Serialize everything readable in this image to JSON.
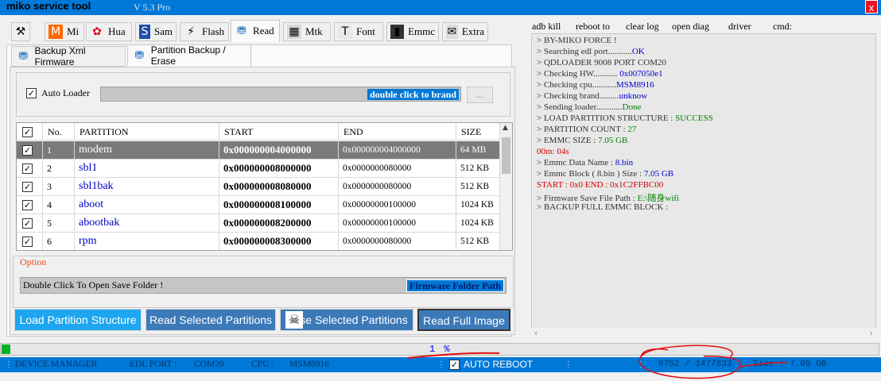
{
  "window": {
    "title": "miko service tool",
    "version": "V 5.3 Pro",
    "close_label": "x"
  },
  "tabs": [
    {
      "label": "",
      "icon": "tools-icon"
    },
    {
      "label": "Mi",
      "icon": "mi-icon"
    },
    {
      "label": "Hua",
      "icon": "huawei-icon"
    },
    {
      "label": "Sam",
      "icon": "samsung-icon"
    },
    {
      "label": "Flash",
      "icon": "lightning-icon"
    },
    {
      "label": "Read",
      "icon": "database-icon"
    },
    {
      "label": "Mtk",
      "icon": "chip-icon"
    },
    {
      "label": "Font",
      "icon": "font-icon"
    },
    {
      "label": "Emmc",
      "icon": "emmc-icon"
    },
    {
      "label": "Extra",
      "icon": "extra-icon"
    }
  ],
  "subtabs": [
    {
      "label": "Backup Xml Firmware",
      "icon": "database-icon"
    },
    {
      "label": "Partition Backup / Erase",
      "icon": "database-icon"
    }
  ],
  "auto_loader": {
    "label": "Auto Loader",
    "checked": true,
    "brand_text": "double click to brand",
    "browse_label": "..."
  },
  "table": {
    "columns": [
      "No.",
      "PARTITION",
      "START",
      "END",
      "SIZE"
    ],
    "rows": [
      {
        "no": "1",
        "name": "modem",
        "start": "0x000000004000000",
        "end": "0x000000004000000",
        "size": "64 MB",
        "selected": true
      },
      {
        "no": "2",
        "name": "sbl1",
        "start": "0x000000008000000",
        "end": "0x0000000080000",
        "size": "512 KB"
      },
      {
        "no": "3",
        "name": "sbl1bak",
        "start": "0x000000008080000",
        "end": "0x0000000080000",
        "size": "512 KB"
      },
      {
        "no": "4",
        "name": "aboot",
        "start": "0x000000008100000",
        "end": "0x00000000100000",
        "size": "1024 KB"
      },
      {
        "no": "5",
        "name": "abootbak",
        "start": "0x000000008200000",
        "end": "0x00000000100000",
        "size": "1024 KB"
      },
      {
        "no": "6",
        "name": "rpm",
        "start": "0x000000008300000",
        "end": "0x0000000080000",
        "size": "512 KB"
      }
    ]
  },
  "option": {
    "label": "Option",
    "save_folder_text": "Double Click To Open Save Folder !",
    "firmware_path_label": "Firmware Folder Path"
  },
  "buttons": {
    "load": "Load Partition Structure",
    "read": "Read Selected Partitions",
    "erase": "se Selected Partitions",
    "full": "Read Full Image"
  },
  "colors": {
    "accent": "#0078d7",
    "selected_button": "#1ea6f0",
    "button": "#3c79b8",
    "success": "#008000",
    "error": "#d00000"
  },
  "right_tabs": [
    "adb kill",
    "reboot to",
    "clear log",
    "open diag",
    "driver",
    "cmd:"
  ],
  "log": [
    {
      "parts": [
        {
          "t": " > BY-MIKO FORCE !",
          "c": "#333"
        }
      ]
    },
    {
      "parts": [
        {
          "t": " > Searching edl port...........",
          "c": "#333"
        },
        {
          "t": "OK",
          "c": "#0000d0"
        }
      ]
    },
    {
      "parts": [
        {
          "t": " > QDLOADER 9008 PORT COM20",
          "c": "#333"
        }
      ]
    },
    {
      "parts": [
        {
          "t": " > Checking HW........... ",
          "c": "#333"
        },
        {
          "t": "0x007050e1",
          "c": "#0000d0"
        }
      ]
    },
    {
      "parts": [
        {
          "t": " > Checking cpu...........",
          "c": "#333"
        },
        {
          "t": "MSM8916",
          "c": "#0000d0"
        }
      ]
    },
    {
      "parts": [
        {
          "t": " > Checking brand.........",
          "c": "#333"
        },
        {
          "t": "unknow",
          "c": "#0000d0"
        }
      ]
    },
    {
      "parts": [
        {
          "t": " > Sending loader............",
          "c": "#333"
        },
        {
          "t": "Done",
          "c": "#008000"
        }
      ]
    },
    {
      "parts": [
        {
          "t": " > LOAD PARTITION  STRUCTURE  :  ",
          "c": "#333"
        },
        {
          "t": "SUCCESS",
          "c": "#008000"
        }
      ]
    },
    {
      "parts": [
        {
          "t": " > PARTITION COUNT  :  ",
          "c": "#333"
        },
        {
          "t": "27",
          "c": "#008000"
        }
      ]
    },
    {
      "parts": [
        {
          "t": " > EMMC SIZE   :  ",
          "c": "#333"
        },
        {
          "t": "7.05 GB",
          "c": "#008000"
        }
      ]
    },
    {
      "parts": [
        {
          "t": "00m: 04s",
          "c": "#d00000"
        }
      ]
    },
    {
      "parts": [
        {
          "t": " > Emmc Data Name  :  ",
          "c": "#333"
        },
        {
          "t": "8.bin",
          "c": "#0000d0"
        }
      ]
    },
    {
      "parts": [
        {
          "t": " > Emmc Block ( 8.bin ) Size   :  ",
          "c": "#333"
        },
        {
          "t": "7.05 GB",
          "c": "#0000d0"
        }
      ]
    },
    {
      "parts": [
        {
          "t": "  START  :  0x0     END  :  0x1C2FFBC00",
          "c": "#d00000"
        }
      ]
    },
    {
      "parts": [
        {
          "t": " > Firmware Save File  Path : ",
          "c": "#333"
        },
        {
          "t": "E:\\随身wifi",
          "c": "#008000"
        }
      ]
    },
    {
      "parts": [
        {
          "t": " > BACKUP FULL EMMC BLOCK   :",
          "c": "#333"
        }
      ]
    }
  ],
  "progress": {
    "value": 0.01,
    "label": "1 %"
  },
  "status": {
    "device_manager": "DEVICE MANAGER",
    "edl_port_label": "EDL PORT  :",
    "edl_port_value": "COM20",
    "cpu_label": "CPU  :",
    "cpu_value": "MSM8916",
    "auto_reboot": "AUTO REBOOT",
    "counter": "6752   /   1477833",
    "size": "Size  :  7.05 GB"
  }
}
